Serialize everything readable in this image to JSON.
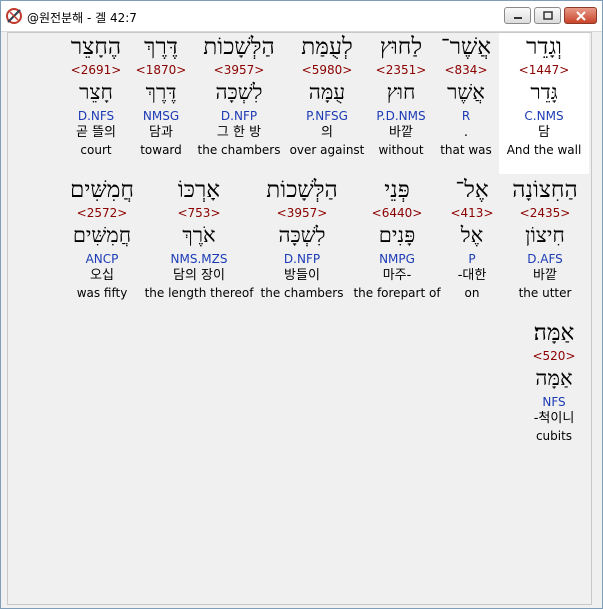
{
  "window": {
    "title": "@원전분해 - 겔 42:7",
    "icon": "compass-ruler-icon",
    "buttons": {
      "minimize": "minimize-icon",
      "maximize": "maximize-icon",
      "close": "close-icon"
    }
  },
  "row1": [
    {
      "heb": "וְגָדֵר",
      "strong": "<1447>",
      "lemma": "גָּדֵר",
      "morph": "C.NMS",
      "kor": "담",
      "eng": "And the wall"
    },
    {
      "heb": "אֲשֶׁר־",
      "strong": "<834>",
      "lemma": "אֲשֶׁר",
      "morph": "R",
      "kor": ".",
      "eng": "that was"
    },
    {
      "heb": "לַחוּץ",
      "strong": "<2351>",
      "lemma": "חוּץ",
      "morph": "P.D.NMS",
      "kor": "바깥",
      "eng": "without"
    },
    {
      "heb": "לְעֻמַּת",
      "strong": "<5980>",
      "lemma": "עֻמָּה",
      "morph": "P.NFSG",
      "kor": "의",
      "eng": "over against"
    },
    {
      "heb": "הַלְּשָׁכוֹת",
      "strong": "<3957>",
      "lemma": "לִשְׁכָּה",
      "morph": "D.NFP",
      "kor": "그 한 방",
      "eng": "the chambers"
    },
    {
      "heb": "דֶּרֶךְ",
      "strong": "<1870>",
      "lemma": "דֶּרֶךְ",
      "morph": "NMSG",
      "kor": "담과",
      "eng": "toward"
    },
    {
      "heb": "הֶחָצֵר",
      "strong": "<2691>",
      "lemma": "חָצֵר",
      "morph": "D.NFS",
      "kor": "곧 뜰의",
      "eng": "court"
    }
  ],
  "row2": [
    {
      "heb": "הַחִצוֹנָה",
      "strong": "<2435>",
      "lemma": "חִיצוֹן",
      "morph": "D.AFS",
      "kor": "바깥",
      "eng": "the utter"
    },
    {
      "heb": "אֶל־",
      "strong": "<413>",
      "lemma": "אֶל",
      "morph": "P",
      "kor": "-대한",
      "eng": "on"
    },
    {
      "heb": "פְּנֵי",
      "strong": "<6440>",
      "lemma": "פָּנִים",
      "morph": "NMPG",
      "kor": "마주-",
      "eng": "the forepart of"
    },
    {
      "heb": "הַלְּשָׁכוֹת",
      "strong": "<3957>",
      "lemma": "לִשְׁכָּה",
      "morph": "D.NFP",
      "kor": "방들이",
      "eng": "the chambers"
    },
    {
      "heb": "אָרְכּוֹ",
      "strong": "<753>",
      "lemma": "אֹרֶךְ",
      "morph": "NMS.MZS",
      "kor": "담의 장이",
      "eng": "the length thereof"
    },
    {
      "heb": "חֲמִשִּׁים",
      "strong": "<2572>",
      "lemma": "חֲמִשִּׁים",
      "morph": "ANCP",
      "kor": "오십",
      "eng": "was fifty"
    }
  ],
  "row3": [
    {
      "heb": "אַמָּה׃",
      "strong": "<520>",
      "lemma": "אַמָּה",
      "morph": "NFS",
      "kor": "-척이니",
      "eng": "cubits"
    }
  ]
}
